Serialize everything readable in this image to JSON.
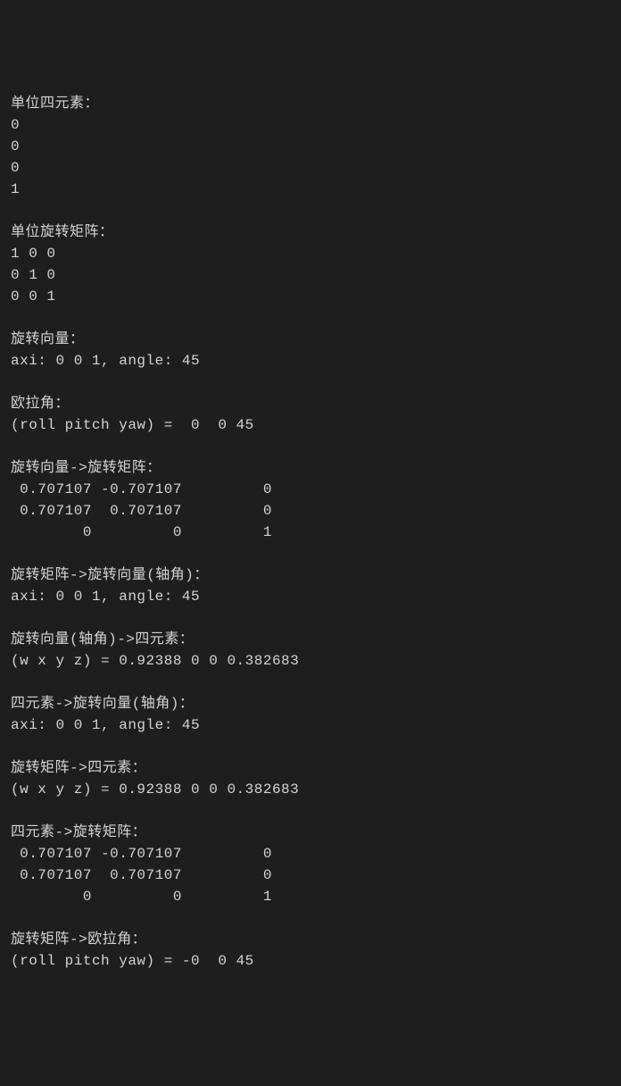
{
  "sections": {
    "unit_quaternion": {
      "label": "单位四元素：",
      "values": [
        "0",
        "0",
        "0",
        "1"
      ]
    },
    "unit_rotation_matrix": {
      "label": "单位旋转矩阵：",
      "rows": [
        "1 0 0",
        "0 1 0",
        "0 0 1"
      ]
    },
    "rotation_vector": {
      "label": "旋转向量：",
      "content": "axi: 0 0 1, angle: 45"
    },
    "euler_angle": {
      "label": "欧拉角：",
      "content": "(roll pitch yaw) =  0  0 45"
    },
    "rotvec_to_rotmat": {
      "label": "旋转向量->旋转矩阵：",
      "rows": [
        " 0.707107 -0.707107         0",
        " 0.707107  0.707107         0",
        "        0         0         1"
      ]
    },
    "rotmat_to_rotvec": {
      "label": "旋转矩阵->旋转向量(轴角)：",
      "content": "axi: 0 0 1, angle: 45"
    },
    "rotvec_to_quat": {
      "label": "旋转向量(轴角)->四元素：",
      "content": "(w x y z) = 0.92388 0 0 0.382683"
    },
    "quat_to_rotvec": {
      "label": "四元素->旋转向量(轴角)：",
      "content": "axi: 0 0 1, angle: 45"
    },
    "rotmat_to_quat": {
      "label": "旋转矩阵->四元素：",
      "content": "(w x y z) = 0.92388 0 0 0.382683"
    },
    "quat_to_rotmat": {
      "label": "四元素->旋转矩阵：",
      "rows": [
        " 0.707107 -0.707107         0",
        " 0.707107  0.707107         0",
        "        0         0         1"
      ]
    },
    "rotmat_to_euler": {
      "label": "旋转矩阵->欧拉角：",
      "content": "(roll pitch yaw) = -0  0 45"
    }
  }
}
